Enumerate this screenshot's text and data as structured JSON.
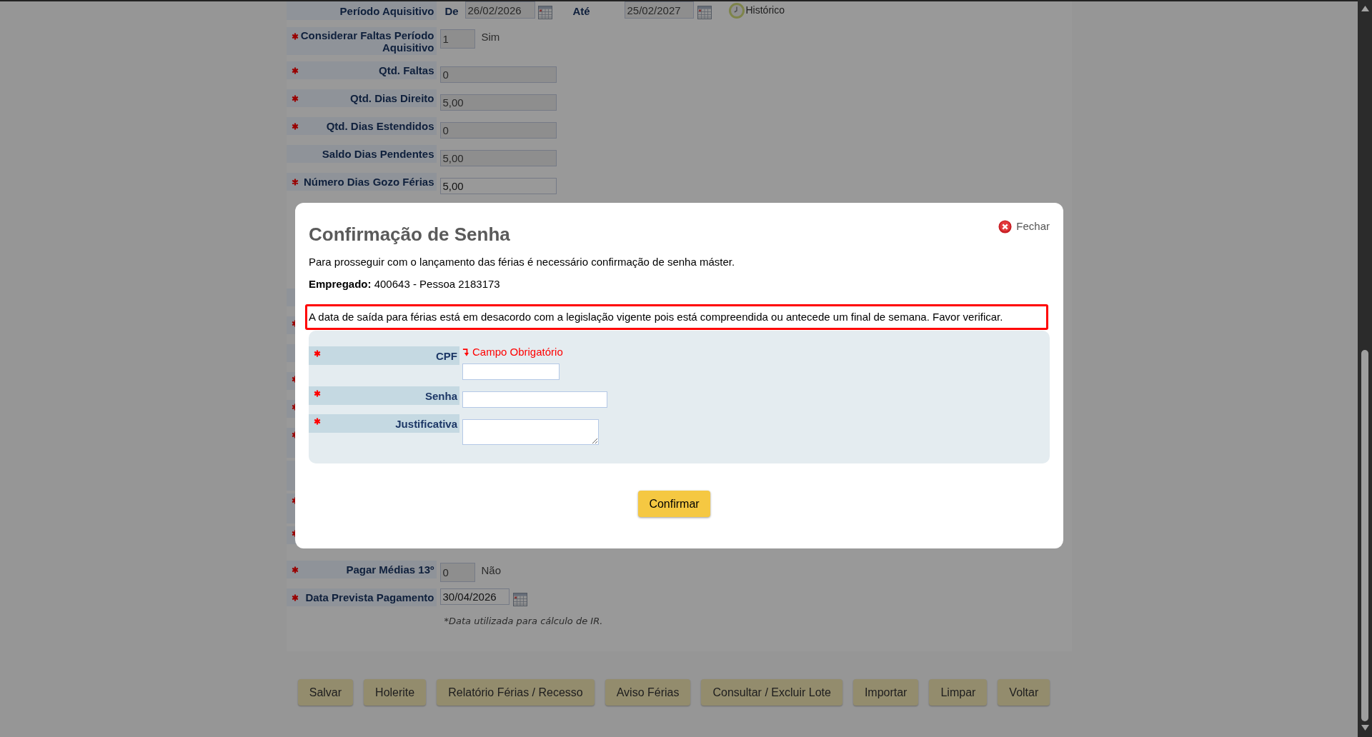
{
  "form": {
    "period": {
      "label": "Período Aquisitivo",
      "required": false,
      "from_label": "De",
      "from": {
        "value": "26/02/2026",
        "disabled": true
      },
      "to_label": "Até",
      "to": {
        "value": "25/02/2027",
        "disabled": true
      },
      "history_link": "Histórico"
    },
    "rows": [
      {
        "kind": "flag",
        "label": "Considerar Faltas Período Aquisitivo",
        "required": true,
        "value": "1",
        "disabled": true,
        "caption": "Sim"
      },
      {
        "kind": "number",
        "label": "Qtd. Faltas",
        "required": true,
        "value": "0",
        "disabled": true
      },
      {
        "kind": "number",
        "label": "Qtd. Dias Direito",
        "required": true,
        "value": "5,00",
        "disabled": true
      },
      {
        "kind": "number",
        "label": "Qtd. Dias Estendidos",
        "required": true,
        "value": "0",
        "disabled": true
      },
      {
        "kind": "number",
        "label": "Saldo Dias Pendentes",
        "required": false,
        "value": "5,00",
        "disabled": true
      },
      {
        "kind": "number",
        "label": "Número Dias Gozo Férias",
        "required": true,
        "value": "5,00",
        "disabled": false
      }
    ],
    "covered_rows": [
      {
        "kind": "short",
        "required": false
      },
      {
        "kind": "short",
        "required": true
      },
      {
        "kind": "short",
        "required": false
      },
      {
        "kind": "short",
        "required": true
      },
      {
        "kind": "short",
        "required": true
      },
      {
        "kind": "tall",
        "required": true
      },
      {
        "kind": "tall",
        "required": false
      },
      {
        "kind": "tall",
        "required": true
      },
      {
        "kind": "short",
        "required": true
      }
    ],
    "rows_below": [
      {
        "kind": "flag",
        "label": "Pagar Médias 13º",
        "required": true,
        "value": "0",
        "disabled": true,
        "caption": "Não"
      },
      {
        "kind": "date",
        "label": "Data Prevista Pagamento",
        "required": true,
        "value": "30/04/2026",
        "disabled": false,
        "hint": "*Data utilizada para cálculo de IR."
      }
    ]
  },
  "buttons": [
    "Salvar",
    "Holerite",
    "Relatório Férias / Recesso",
    "Aviso Férias",
    "Consultar / Excluir Lote",
    "Importar",
    "Limpar",
    "Voltar"
  ],
  "modal": {
    "title": "Confirmação de Senha",
    "close_label": "Fechar",
    "intro": "Para prosseguir com o lançamento das férias é necessário confirmação de senha máster.",
    "employee": "**Empregado:** 400643 - Pessoa 2183173",
    "alert": "A data de saída para férias está em desacordo com a legislação vigente pois está compreendida ou antecede um final de semana. Favor verificar.",
    "fields": [
      {
        "kind": "text",
        "label": "CPF",
        "required": true,
        "error": "Campo Obrigatório"
      },
      {
        "kind": "password",
        "label": "Senha",
        "required": true
      },
      {
        "kind": "textarea",
        "label": "Justificativa",
        "required": true
      }
    ],
    "confirm_button": "Confirmar"
  }
}
